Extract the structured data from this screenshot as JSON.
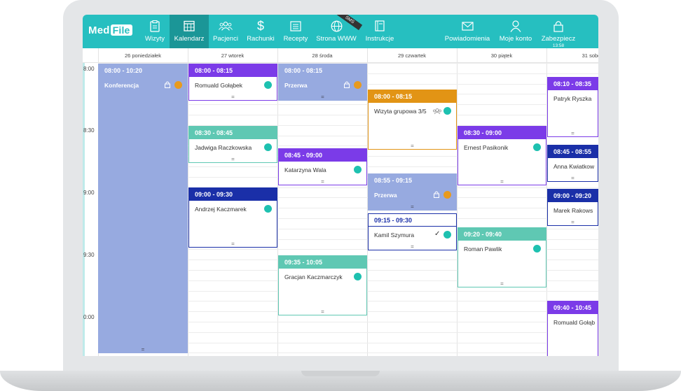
{
  "brand": {
    "part1": "Med",
    "part2": "File"
  },
  "nav": {
    "items": [
      {
        "label": "Wizyty",
        "icon": "clipboard-icon"
      },
      {
        "label": "Kalendarz",
        "icon": "calendar-icon"
      },
      {
        "label": "Pacjenci",
        "icon": "users-icon"
      },
      {
        "label": "Rachunki",
        "icon": "dollar-icon"
      },
      {
        "label": "Recepty",
        "icon": "list-icon"
      },
      {
        "label": "Strona WWW",
        "icon": "globe-icon"
      },
      {
        "label": "Instrukcje",
        "icon": "book-icon"
      },
      {
        "label": "Powiadomienia",
        "icon": "mail-icon"
      },
      {
        "label": "Moje konto",
        "icon": "user-icon"
      },
      {
        "label": "Zabezpiecz",
        "icon": "lock-icon",
        "sub": "13:58"
      }
    ],
    "ribbon": "SMS"
  },
  "days": [
    "26 poniedziałek",
    "27 wtorek",
    "28 środa",
    "29 czwartek",
    "30 piątek",
    "31 sobo"
  ],
  "times": [
    "8:00",
    "8:30",
    "9:00",
    "9:30",
    "0:00"
  ],
  "events": [
    {
      "time": "08:00 - 10:20",
      "name": "Konferencja",
      "color": "#97aae0",
      "style": "fill",
      "marker": "lock-orange"
    },
    {
      "time": "08:00 - 08:15",
      "name": "Romuald Gołąbek",
      "color": "#7b3be8",
      "marker": "dot"
    },
    {
      "time": "08:30 - 08:45",
      "name": "Jadwiga Raczkowska",
      "color": "#5fc8b3",
      "marker": "dot"
    },
    {
      "time": "09:00 - 09:30",
      "name": "Andrzej Kaczmarek",
      "color": "#1a2fa8",
      "marker": "dot"
    },
    {
      "time": "08:00 - 08:15",
      "name": "Przerwa",
      "color": "#97aae0",
      "style": "fill",
      "marker": "lock-orange"
    },
    {
      "time": "08:45 - 09:00",
      "name": "Katarzyna Wala",
      "color": "#7b3be8",
      "marker": "dot"
    },
    {
      "time": "09:35 - 10:05",
      "name": "Gracjan Kaczmarczyk",
      "color": "#5fc8b3",
      "marker": "dot"
    },
    {
      "time": "08:00 - 08:15",
      "name": "Wizyta grupowa 3/5",
      "color": "#e29415",
      "marker": "group-dot"
    },
    {
      "time": "08:55 - 09:15",
      "name": "Przerwa",
      "color": "#97aae0",
      "style": "fill",
      "marker": "lock-orange"
    },
    {
      "time": "09:15 - 09:30",
      "name": "Kamil Szymura",
      "color": "#1a2fa8",
      "style": "outline",
      "marker": "check-dot"
    },
    {
      "time": "08:30 - 09:00",
      "name": "Ernest Pasikonik",
      "color": "#7b3be8",
      "marker": "dot"
    },
    {
      "time": "09:20 - 09:40",
      "name": "Roman Pawlik",
      "color": "#5fc8b3",
      "marker": "dot"
    },
    {
      "time": "08:10 - 08:35",
      "name": "Patryk Ryszka",
      "color": "#7b3be8",
      "marker": "none"
    },
    {
      "time": "08:45 - 08:55",
      "name": "Anna Kwiatkow",
      "color": "#1a2fa8",
      "marker": "none"
    },
    {
      "time": "09:00 - 09:20",
      "name": "Marek Rakows",
      "color": "#1a2fa8",
      "marker": "none"
    },
    {
      "time": "09:40 - 10:45",
      "name": "Romuald Gołąb",
      "color": "#7b3be8",
      "marker": "none"
    }
  ],
  "handle": "="
}
